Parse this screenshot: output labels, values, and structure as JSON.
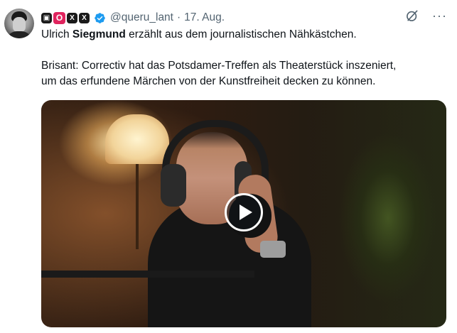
{
  "post": {
    "badges": [
      {
        "icon": "tv-badge-icon",
        "glyph": "▣"
      },
      {
        "icon": "o-badge-icon",
        "glyph": "O"
      },
      {
        "icon": "x-badge-icon",
        "glyph": "X"
      },
      {
        "icon": "x-badge-icon",
        "glyph": "X"
      }
    ],
    "verified_icon": "verified-badge-icon",
    "handle": "@queru_lant",
    "separator": "·",
    "date": "17. Aug.",
    "text": {
      "line1_pre": "Ulrich ",
      "line1_bold": "Siegmund",
      "line1_post": " erzählt aus dem journalistischen Nähkästchen.",
      "line2": "Brisant: Correctiv hat das Potsdamer-Treffen als Theaterstück inszeniert,",
      "line3": "um das erfundene Märchen von der Kunstfreiheit decken zu können."
    },
    "actions": {
      "grok_icon": "grok-icon",
      "more_icon": "more-horizontal-icon",
      "more_glyph": "···"
    },
    "media": {
      "type": "video",
      "play_icon": "play-icon"
    }
  },
  "colors": {
    "text": "#0f1419",
    "secondary": "#536471",
    "verified": "#1d9bf0",
    "red_badge": "#e0245e"
  }
}
